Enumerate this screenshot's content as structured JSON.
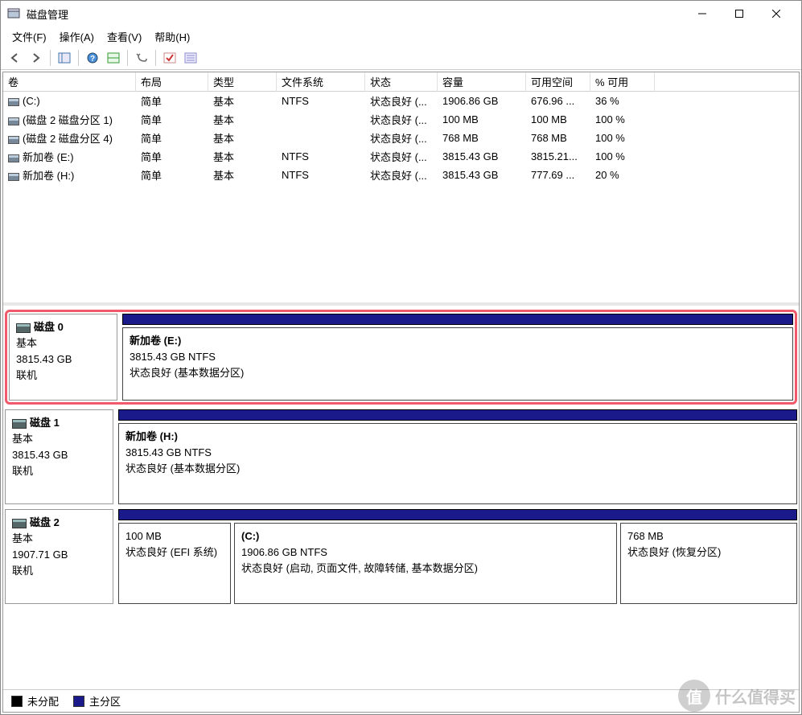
{
  "window": {
    "title": "磁盘管理"
  },
  "menus": {
    "file": "文件(F)",
    "action": "操作(A)",
    "view": "查看(V)",
    "help": "帮助(H)"
  },
  "columns": {
    "volume": "卷",
    "layout": "布局",
    "type": "类型",
    "fs": "文件系统",
    "status": "状态",
    "capacity": "容量",
    "free": "可用空间",
    "pct": "% 可用"
  },
  "volumes": [
    {
      "name": "(C:)",
      "layout": "简单",
      "type": "基本",
      "fs": "NTFS",
      "status": "状态良好 (...",
      "cap": "1906.86 GB",
      "free": "676.96 ...",
      "pct": "36 %"
    },
    {
      "name": "(磁盘 2 磁盘分区 1)",
      "layout": "简单",
      "type": "基本",
      "fs": "",
      "status": "状态良好 (...",
      "cap": "100 MB",
      "free": "100 MB",
      "pct": "100 %"
    },
    {
      "name": "(磁盘 2 磁盘分区 4)",
      "layout": "简单",
      "type": "基本",
      "fs": "",
      "status": "状态良好 (...",
      "cap": "768 MB",
      "free": "768 MB",
      "pct": "100 %"
    },
    {
      "name": "新加卷 (E:)",
      "layout": "简单",
      "type": "基本",
      "fs": "NTFS",
      "status": "状态良好 (...",
      "cap": "3815.43 GB",
      "free": "3815.21...",
      "pct": "100 %"
    },
    {
      "name": "新加卷 (H:)",
      "layout": "简单",
      "type": "基本",
      "fs": "NTFS",
      "status": "状态良好 (...",
      "cap": "3815.43 GB",
      "free": "777.69 ...",
      "pct": "20 %"
    }
  ],
  "disks": {
    "d0": {
      "title": "磁盘 0",
      "type": "基本",
      "size": "3815.43 GB",
      "state": "联机",
      "p0": {
        "name": "新加卷  (E:)",
        "detail": "3815.43 GB NTFS",
        "status": "状态良好 (基本数据分区)"
      }
    },
    "d1": {
      "title": "磁盘 1",
      "type": "基本",
      "size": "3815.43 GB",
      "state": "联机",
      "p0": {
        "name": "新加卷  (H:)",
        "detail": "3815.43 GB NTFS",
        "status": "状态良好 (基本数据分区)"
      }
    },
    "d2": {
      "title": "磁盘 2",
      "type": "基本",
      "size": "1907.71 GB",
      "state": "联机",
      "p0": {
        "name": "",
        "detail": "100 MB",
        "status": "状态良好 (EFI 系统)"
      },
      "p1": {
        "name": "(C:)",
        "detail": "1906.86 GB NTFS",
        "status": "状态良好 (启动, 页面文件, 故障转储, 基本数据分区)"
      },
      "p2": {
        "name": "",
        "detail": "768 MB",
        "status": "状态良好 (恢复分区)"
      }
    }
  },
  "legend": {
    "unalloc": "未分配",
    "primary": "主分区"
  },
  "watermark": "什么值得买"
}
